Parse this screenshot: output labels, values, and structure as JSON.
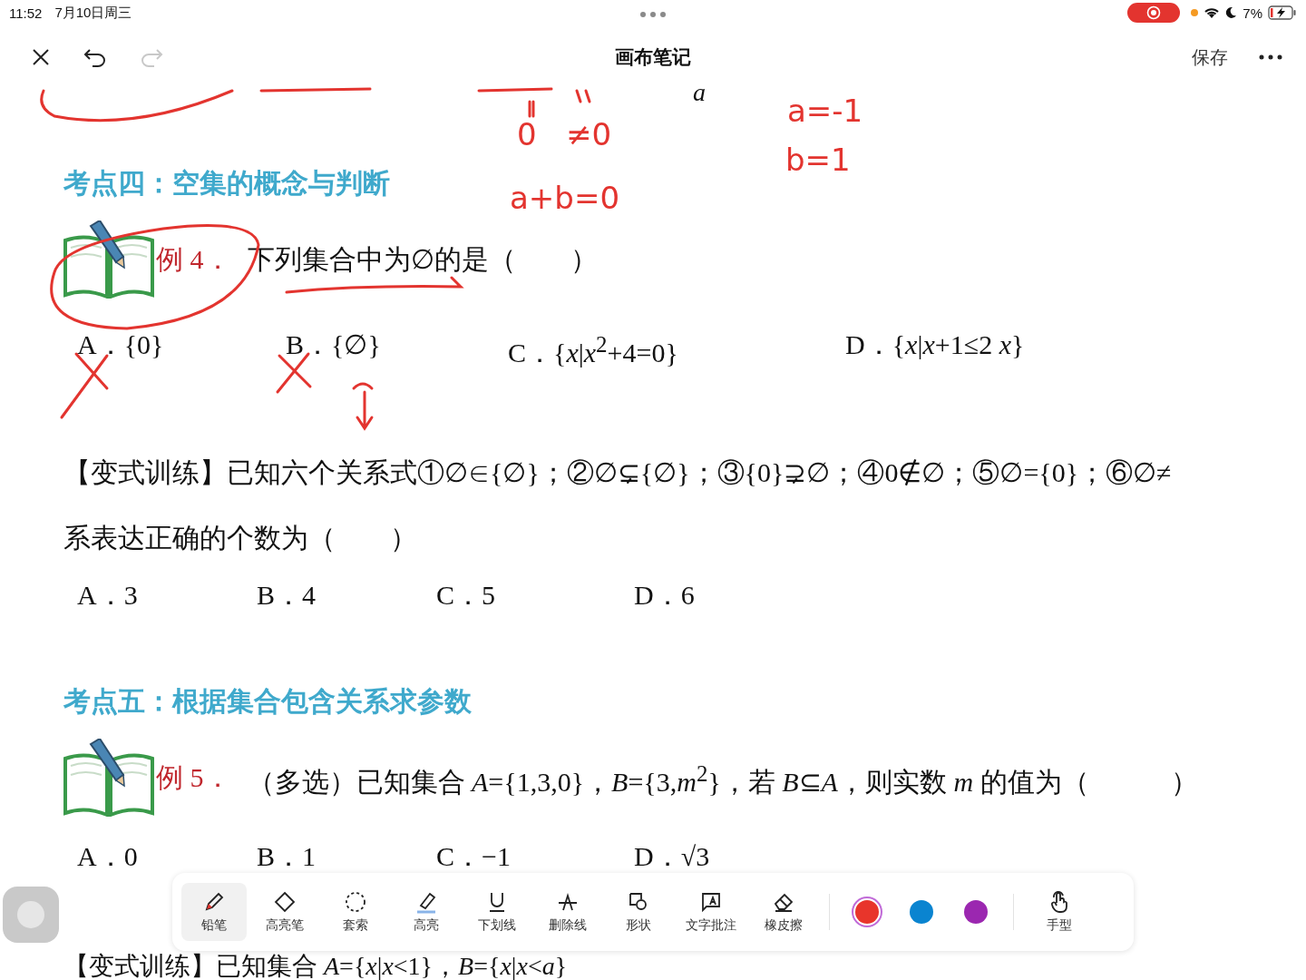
{
  "status_bar": {
    "time": "11:52",
    "date": "7月10日周三",
    "battery": "7%",
    "recording": true
  },
  "header": {
    "title": "画布笔记",
    "save": "保存",
    "redo_enabled": false
  },
  "top_fragment": "a",
  "ink_notes": [
    {
      "text": "a=-1"
    },
    {
      "text": "0"
    },
    {
      "text": "≠0"
    },
    {
      "text": "b=1"
    },
    {
      "text": "a+b=0"
    }
  ],
  "sections": [
    {
      "kind": "heading",
      "text": "考点四：空集的概念与判断"
    },
    {
      "kind": "example",
      "label": "例 4．",
      "text": "下列集合中为∅的是（　　）"
    },
    {
      "kind": "options_wide",
      "items": [
        "A．{0}",
        "B．{∅}",
        "C．{*x*|*x*$^{2}$+4=0}",
        "D．{*x*|*x*+1≤2 *x*}"
      ]
    },
    {
      "kind": "paragraph",
      "text": "【变式训练】已知六个关系式①∅∈{∅}；②∅⊊{∅}；③{0}⊋∅；④0∉∅；⑤∅={0}；⑥∅≠"
    },
    {
      "kind": "paragraph",
      "text": "系表达正确的个数为（　　）"
    },
    {
      "kind": "options",
      "items": [
        "A．3",
        "B．4",
        "C．5",
        "D．6"
      ]
    },
    {
      "kind": "heading",
      "text": "考点五：根据集合包含关系求参数"
    },
    {
      "kind": "example",
      "label": "例 5．",
      "text": "（多选）已知集合 *A*={1,3,0}，*B*={3,*m*$^{2}$}，若 *B*⊆*A*，则实数 *m* 的值为（　　　）"
    },
    {
      "kind": "options",
      "items": [
        "A．0",
        "B．1",
        "C．−1",
        "D．√3"
      ]
    },
    {
      "kind": "paragraph",
      "text": "【变式训练】已知集合 *A*={*x*|*x*<1}，*B*={*x*|*x*<*a*}"
    }
  ],
  "toolbar": {
    "tools": [
      {
        "label": "铅笔",
        "kind": "pencil",
        "selected": true
      },
      {
        "label": "高亮笔",
        "kind": "diamond",
        "selected": false
      },
      {
        "label": "套索",
        "kind": "lasso",
        "selected": false
      },
      {
        "label": "高亮",
        "kind": "highlighter",
        "selected": false
      },
      {
        "label": "下划线",
        "kind": "underline",
        "selected": false
      },
      {
        "label": "删除线",
        "kind": "strike",
        "selected": false
      },
      {
        "label": "形状",
        "kind": "shape",
        "selected": false
      },
      {
        "label": "文字批注",
        "kind": "textnote",
        "selected": false
      },
      {
        "label": "橡皮擦",
        "kind": "eraser",
        "selected": false
      }
    ],
    "colors": [
      {
        "color": "#e8352b",
        "selected": true
      },
      {
        "color": "#0a84d0",
        "selected": false
      },
      {
        "color": "#9b27b0",
        "selected": false
      }
    ],
    "hand": {
      "label": "手型"
    }
  }
}
